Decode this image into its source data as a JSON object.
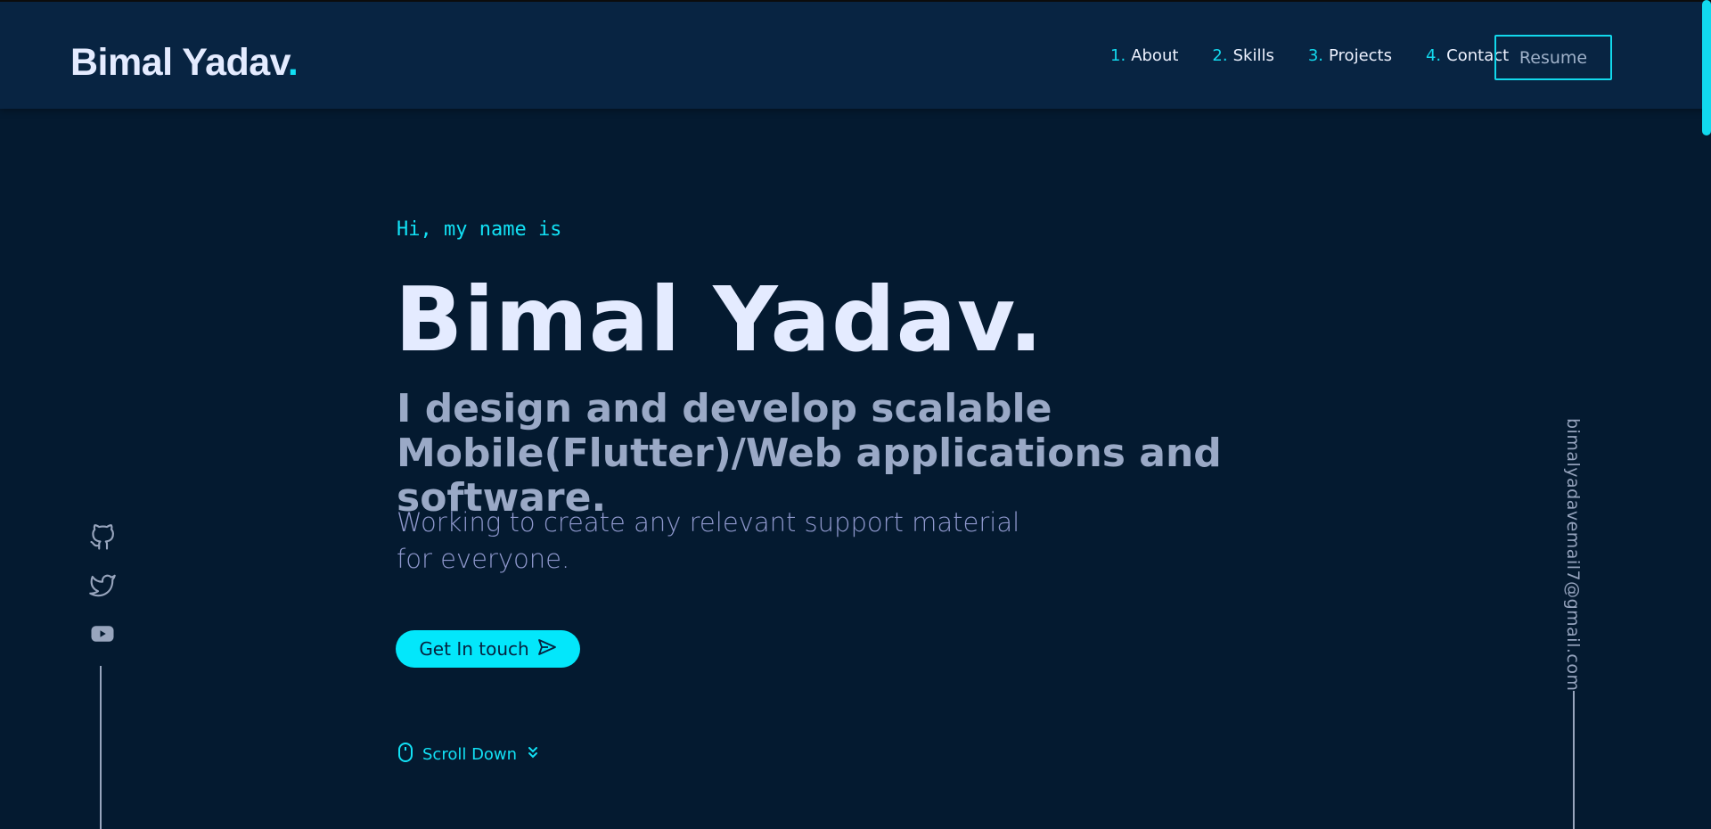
{
  "header": {
    "logo_text": "Bimal Yadav",
    "logo_dot": ".",
    "nav": [
      {
        "num": "1.",
        "label": "About"
      },
      {
        "num": "2.",
        "label": "Skills"
      },
      {
        "num": "3.",
        "label": "Projects"
      },
      {
        "num": "4.",
        "label": "Contact"
      }
    ],
    "resume_label": "Resume"
  },
  "hero": {
    "greeting": "Hi, my name is",
    "name": "Bimal Yadav.",
    "tagline": "I design and develop scalable Mobile(Flutter)/Web applications and software.",
    "subtitle": "Working to create any relevant support material for everyone.",
    "cta_label": "Get In touch",
    "scroll_label": "Scroll Down"
  },
  "social": {
    "icons": [
      "github-icon",
      "twitter-icon",
      "youtube-icon"
    ]
  },
  "email": "bimalyadavemail7@gmail.com",
  "colors": {
    "background": "#041a30",
    "header": "#082442",
    "accent": "#12e1f5",
    "heading": "#e4ebff",
    "muted": "#9aa9c6"
  }
}
